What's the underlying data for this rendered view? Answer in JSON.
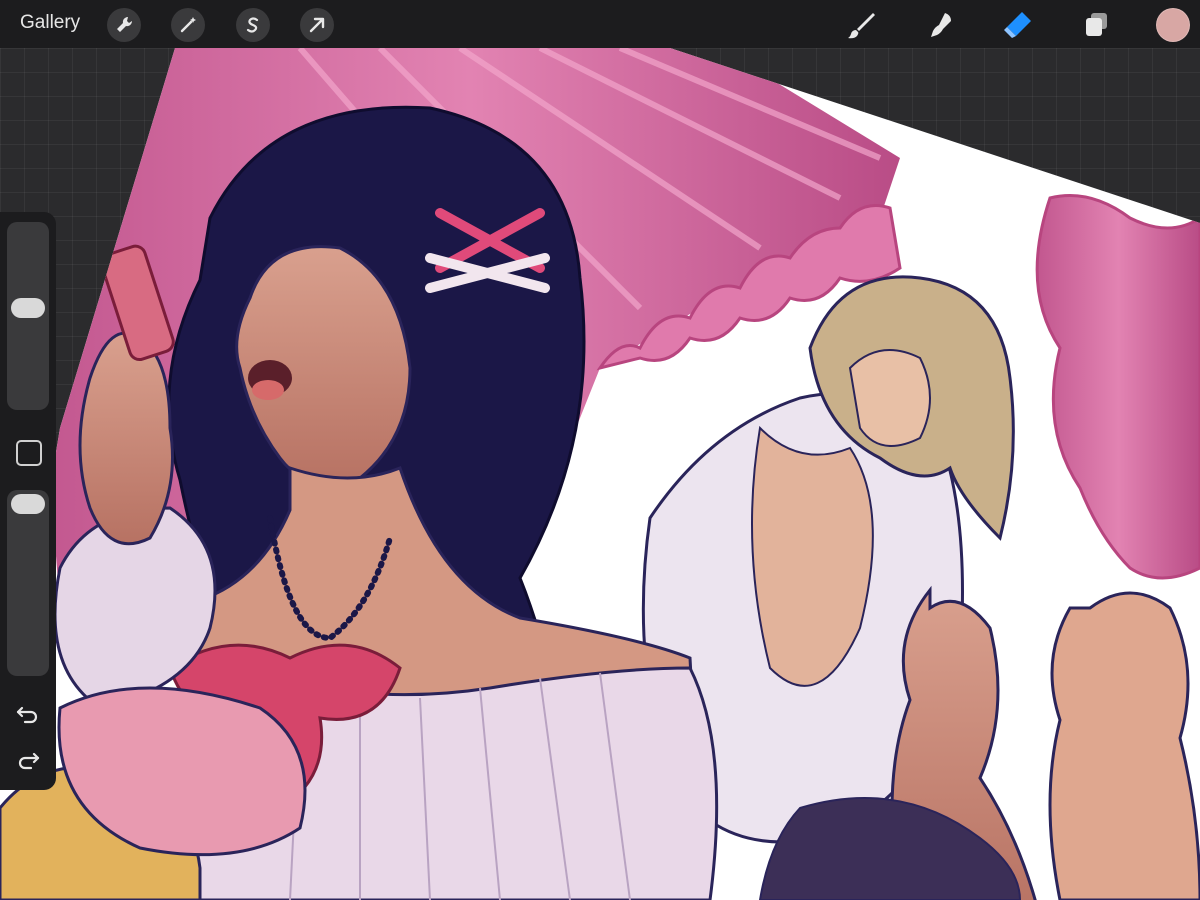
{
  "topbar": {
    "gallery_label": "Gallery",
    "left_tools": [
      "wrench-icon",
      "magic-wand-icon",
      "selection-s-icon",
      "transform-arrow-icon"
    ],
    "right_tools": [
      "brush-icon",
      "smudge-icon",
      "eraser-icon",
      "layers-icon"
    ],
    "active_tool": "eraser-icon",
    "current_color": "#d8a7a4"
  },
  "sidebar": {
    "brush_size_level": 0.46,
    "opacity_level": 0.04,
    "modify_button": "square-icon",
    "undo": "undo-icon",
    "redo": "redo-icon"
  },
  "colors": {
    "accent": "#1e90ff",
    "chrome": "#1c1c1e",
    "canvas_bg": "#2b2b2d"
  }
}
